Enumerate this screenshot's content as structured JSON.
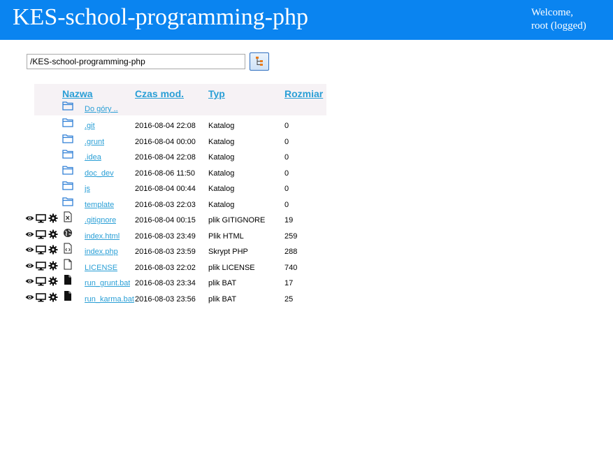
{
  "app": {
    "title": "KES-school-programming-php",
    "welcome_line1": "Welcome,",
    "welcome_line2": "root (logged)"
  },
  "path": {
    "value": "/KES-school-programming-php"
  },
  "colors": {
    "header_bar": "#0a84f0",
    "link": "#2a9fd6",
    "folder": "#2f7fd6",
    "table_header_bg": "#f6f2f5"
  },
  "table": {
    "headers": {
      "name": "Nazwa",
      "time": "Czas mod.",
      "type": "Typ",
      "size": "Rozmiar"
    },
    "up_label": "Do góry ..",
    "rows": [
      {
        "name": ".git",
        "date": "2016-08-04 22:08",
        "type": "Katalog",
        "size": "0",
        "icon": "folder-icon",
        "actions": false
      },
      {
        "name": ".grunt",
        "date": "2016-08-04 00:00",
        "type": "Katalog",
        "size": "0",
        "icon": "folder-icon",
        "actions": false
      },
      {
        "name": ".idea",
        "date": "2016-08-04 22:08",
        "type": "Katalog",
        "size": "0",
        "icon": "folder-icon",
        "actions": false
      },
      {
        "name": "doc_dev",
        "date": "2016-08-06 11:50",
        "type": "Katalog",
        "size": "0",
        "icon": "folder-icon",
        "actions": false
      },
      {
        "name": "js",
        "date": "2016-08-04 00:44",
        "type": "Katalog",
        "size": "0",
        "icon": "folder-icon",
        "actions": false
      },
      {
        "name": "template",
        "date": "2016-08-03 22:03",
        "type": "Katalog",
        "size": "0",
        "icon": "folder-icon",
        "actions": false
      },
      {
        "name": ".gitignore",
        "date": "2016-08-04 00:15",
        "type": "plik GITIGNORE",
        "size": "19",
        "icon": "text-file-icon",
        "actions": true
      },
      {
        "name": "index.html",
        "date": "2016-08-03 23:49",
        "type": "Plik HTML",
        "size": "259",
        "icon": "globe-icon",
        "actions": true
      },
      {
        "name": "index.php",
        "date": "2016-08-03 23:59",
        "type": "Skrypt PHP",
        "size": "288",
        "icon": "code-file-icon",
        "actions": true
      },
      {
        "name": "LICENSE",
        "date": "2016-08-03 22:02",
        "type": "plik LICENSE",
        "size": "740",
        "icon": "blank-file-icon",
        "actions": true
      },
      {
        "name": "run_grunt.bat",
        "date": "2016-08-03 23:34",
        "type": "plik BAT",
        "size": "17",
        "icon": "filled-file-icon",
        "actions": true
      },
      {
        "name": "run_karma.bat",
        "date": "2016-08-03 23:56",
        "type": "plik BAT",
        "size": "25",
        "icon": "filled-file-icon",
        "actions": true
      }
    ]
  }
}
